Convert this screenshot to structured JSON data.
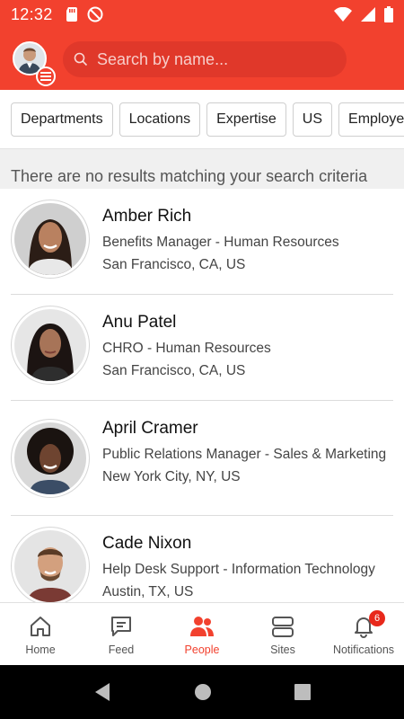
{
  "status_bar": {
    "time": "12:32"
  },
  "header": {
    "search_placeholder": "Search by name..."
  },
  "filters": [
    {
      "label": "Departments"
    },
    {
      "label": "Locations"
    },
    {
      "label": "Expertise"
    },
    {
      "label": "US"
    },
    {
      "label": "Employee"
    }
  ],
  "message": "There are no results matching your search criteria",
  "people": [
    {
      "name": "Amber Rich",
      "title": "Benefits Manager - Human Resources",
      "location": "San Francisco, CA, US",
      "photo": "woman-portrait"
    },
    {
      "name": "Anu Patel",
      "title": "CHRO - Human Resources",
      "location": "San Francisco, CA, US",
      "photo": "woman-portrait"
    },
    {
      "name": "April Cramer",
      "title": "Public Relations Manager - Sales & Marketing",
      "location": "New York City, NY, US",
      "photo": "woman-portrait"
    },
    {
      "name": "Cade Nixon",
      "title": "Help Desk Support - Information Technology",
      "location": "Austin, TX, US",
      "photo": "man-portrait"
    }
  ],
  "bottom_nav": {
    "home": "Home",
    "feed": "Feed",
    "people": "People",
    "sites": "Sites",
    "notifications": "Notifications",
    "notifications_count": "6"
  },
  "colors": {
    "brand": "#f2412e",
    "badge": "#e8281b"
  }
}
